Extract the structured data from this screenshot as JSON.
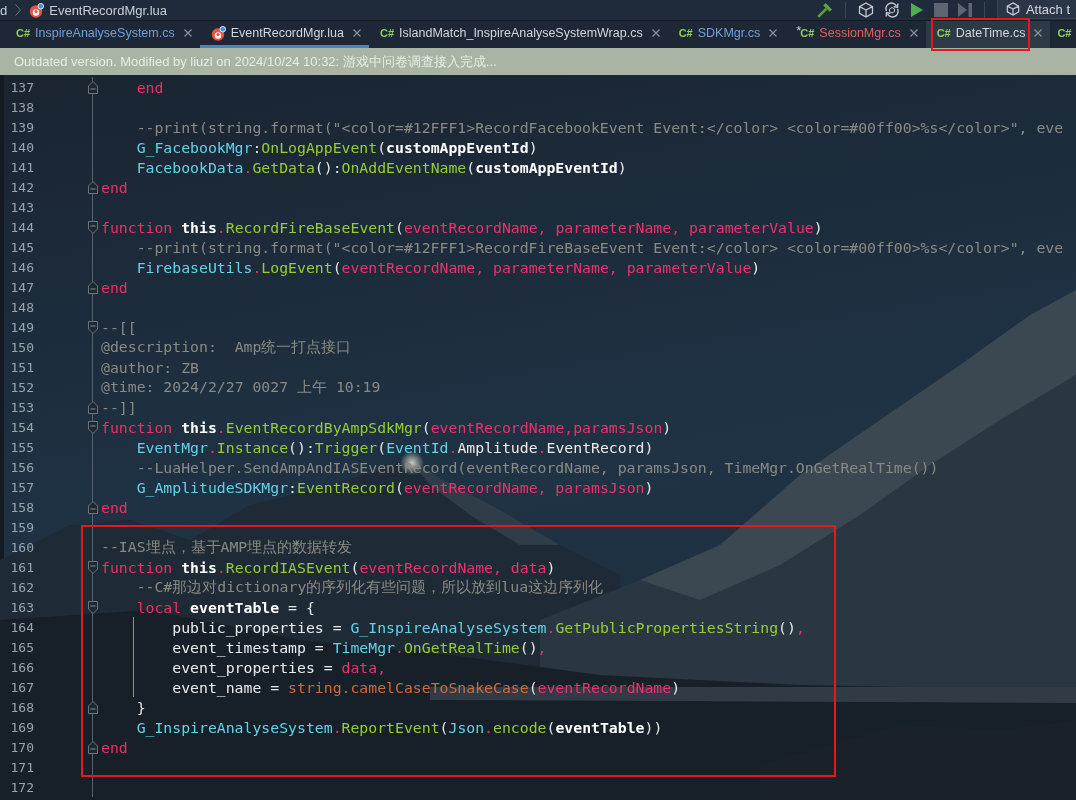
{
  "breadcrumb": [
    {
      "kind": "folder",
      "text": "d"
    },
    {
      "kind": "lua",
      "text": "EventRecordMgr.lua"
    }
  ],
  "toolbar": {
    "groups": [
      {
        "buttons": [
          {
            "kind": "build",
            "disabled": false
          }
        ]
      },
      {
        "buttons": [
          {
            "kind": "cube",
            "disabled": false
          },
          {
            "kind": "refresh",
            "disabled": false
          },
          {
            "kind": "run",
            "disabled": false
          },
          {
            "kind": "stop",
            "disabled": true
          },
          {
            "kind": "step",
            "disabled": true
          }
        ]
      }
    ],
    "attach_button": {
      "label": "Attach t"
    }
  },
  "tabs": [
    {
      "kind": "csharp",
      "badge": "C#",
      "label": "InspireAnalyseSystem.cs",
      "color": "#6fa0dc",
      "selected": false,
      "hovered": false,
      "annotated": false,
      "closable": true
    },
    {
      "kind": "lua",
      "label": "EventRecordMgr.lua",
      "color": "#d2d6dc",
      "selected": true,
      "hovered": false,
      "annotated": false,
      "closable": true
    },
    {
      "kind": "csharp",
      "badge": "C#",
      "label": "IslandMatch_InspireAnalyseSystemWrap.cs",
      "color": "#d2d6dc",
      "selected": false,
      "hovered": false,
      "annotated": false,
      "closable": true
    },
    {
      "kind": "csharp",
      "badge": "C#",
      "label": "SDKMgr.cs",
      "color": "#6fa0dc",
      "selected": false,
      "hovered": false,
      "annotated": false,
      "closable": true
    },
    {
      "kind": "csharp",
      "badge": "C#",
      "marker": "*",
      "label": "SessionMgr.cs",
      "color": "#e0625c",
      "selected": false,
      "hovered": false,
      "annotated": false,
      "closable": true
    },
    {
      "kind": "csharp",
      "badge": "C#",
      "label": "DateTime.cs",
      "color": "#d2d6dc",
      "selected": false,
      "hovered": true,
      "annotated": true,
      "closable": true
    },
    {
      "kind": "csharp",
      "badge": "C#",
      "selected": false,
      "hovered": false,
      "annotated": false
    }
  ],
  "banner": {
    "text": "Outdated version. Modified by liuzl on 2024/10/24 10:32: 游戏中问卷调查接入完成..."
  },
  "code_blocks": [
    {
      "boxed": false,
      "lines": [
        {
          "number": "137",
          "kind": "fold-end",
          "scope_guide": false,
          "tokens": [
            {
              "kind": "keyword",
              "text": "    end"
            }
          ]
        },
        {
          "number": "138",
          "kind": "plain",
          "scope_guide": false
        },
        {
          "number": "139",
          "kind": "plain",
          "scope_guide": false,
          "tokens": [
            {
              "kind": "comment",
              "text": "    --print(string.format(\"<color=#12FFF1>RecordFacebookEvent Event:</color> <color=#00ff00>%s</color>\", eve"
            }
          ]
        },
        {
          "number": "140",
          "kind": "plain",
          "scope_guide": false,
          "tokens": [
            {
              "kind": "global",
              "text": "    G_FacebookMgr"
            },
            {
              "kind": "punct",
              "text": ":"
            },
            {
              "kind": "method",
              "text": "OnLogAppEvent"
            },
            {
              "kind": "punct",
              "text": "("
            },
            {
              "kind": "local",
              "text": "customAppEventId"
            },
            {
              "kind": "punct",
              "text": ")"
            }
          ]
        },
        {
          "number": "141",
          "kind": "plain",
          "scope_guide": false,
          "tokens": [
            {
              "kind": "global",
              "text": "    FacebookData"
            },
            {
              "kind": "operator",
              "text": "."
            },
            {
              "kind": "method",
              "text": "GetData"
            },
            {
              "kind": "punct",
              "text": "():"
            },
            {
              "kind": "method",
              "text": "OnAddEventName"
            },
            {
              "kind": "punct",
              "text": "("
            },
            {
              "kind": "local",
              "text": "customAppEventId"
            },
            {
              "kind": "punct",
              "text": ")"
            }
          ]
        },
        {
          "number": "142",
          "kind": "fold-end",
          "scope_guide": false,
          "tokens": [
            {
              "kind": "keyword",
              "text": "end"
            }
          ]
        },
        {
          "number": "143",
          "kind": "plain",
          "scope_guide": false
        },
        {
          "number": "144",
          "kind": "fold-start",
          "scope_guide": false,
          "tokens": [
            {
              "kind": "keyword",
              "text": "function "
            },
            {
              "kind": "self",
              "text": "this"
            },
            {
              "kind": "operator",
              "text": "."
            },
            {
              "kind": "method",
              "text": "RecordFireBaseEvent"
            },
            {
              "kind": "punct",
              "text": "("
            },
            {
              "kind": "param",
              "text": "eventRecordName, parameterName, parameterValue"
            },
            {
              "kind": "punct",
              "text": ")"
            }
          ]
        },
        {
          "number": "145",
          "kind": "plain",
          "scope_guide": false,
          "tokens": [
            {
              "kind": "comment",
              "text": "    --print(string.format(\"<color=#12FFF1>RecordFireBaseEvent Event:</color> <color=#00ff00>%s</color>\", eve"
            }
          ]
        },
        {
          "number": "146",
          "kind": "plain",
          "scope_guide": false,
          "tokens": [
            {
              "kind": "global",
              "text": "    FirebaseUtils"
            },
            {
              "kind": "operator",
              "text": "."
            },
            {
              "kind": "method",
              "text": "LogEvent"
            },
            {
              "kind": "punct",
              "text": "("
            },
            {
              "kind": "param",
              "text": "eventRecordName, parameterName, parameterValue"
            },
            {
              "kind": "punct",
              "text": ")"
            }
          ]
        },
        {
          "number": "147",
          "kind": "fold-end",
          "scope_guide": false,
          "tokens": [
            {
              "kind": "keyword",
              "text": "end"
            }
          ]
        },
        {
          "number": "148",
          "kind": "plain",
          "scope_guide": false
        },
        {
          "number": "149",
          "kind": "fold-start",
          "scope_guide": false,
          "tokens": [
            {
              "kind": "comment",
              "text": "--[["
            }
          ]
        },
        {
          "number": "150",
          "kind": "plain",
          "scope_guide": false,
          "tokens": [
            {
              "kind": "comment",
              "text": "@description:  Amp统一打点接口"
            }
          ]
        },
        {
          "number": "151",
          "kind": "plain",
          "scope_guide": false,
          "tokens": [
            {
              "kind": "comment",
              "text": "@author: ZB"
            }
          ]
        },
        {
          "number": "152",
          "kind": "plain",
          "scope_guide": false,
          "tokens": [
            {
              "kind": "comment",
              "text": "@time: 2024/2/27 0027 上午 10:19"
            }
          ]
        },
        {
          "number": "153",
          "kind": "fold-end",
          "scope_guide": false,
          "tokens": [
            {
              "kind": "comment",
              "text": "--]]"
            }
          ]
        },
        {
          "number": "154",
          "kind": "fold-start",
          "scope_guide": false,
          "tokens": [
            {
              "kind": "keyword",
              "text": "function "
            },
            {
              "kind": "self",
              "text": "this"
            },
            {
              "kind": "operator",
              "text": "."
            },
            {
              "kind": "method",
              "text": "EventRecordByAmpSdkMgr"
            },
            {
              "kind": "punct",
              "text": "("
            },
            {
              "kind": "param",
              "text": "eventRecordName,paramsJson"
            },
            {
              "kind": "punct",
              "text": ")"
            }
          ]
        },
        {
          "number": "155",
          "kind": "plain",
          "scope_guide": false,
          "tokens": [
            {
              "kind": "global",
              "text": "    EventMgr"
            },
            {
              "kind": "operator",
              "text": "."
            },
            {
              "kind": "method",
              "text": "Instance"
            },
            {
              "kind": "punct",
              "text": "():"
            },
            {
              "kind": "method",
              "text": "Trigger"
            },
            {
              "kind": "punct",
              "text": "("
            },
            {
              "kind": "global",
              "text": "EventId"
            },
            {
              "kind": "operator",
              "text": "."
            },
            {
              "kind": "field",
              "text": "Amplitude"
            },
            {
              "kind": "operator",
              "text": "."
            },
            {
              "kind": "field",
              "text": "EventRecord"
            },
            {
              "kind": "punct",
              "text": ")"
            }
          ]
        },
        {
          "number": "156",
          "kind": "plain",
          "scope_guide": false,
          "tokens": [
            {
              "kind": "comment",
              "text": "    --LuaHelper.SendAmpAndIASEventRecord(eventRecordName, paramsJson, TimeMgr.OnGetRealTime())"
            }
          ]
        },
        {
          "number": "157",
          "kind": "plain",
          "scope_guide": false,
          "tokens": [
            {
              "kind": "global",
              "text": "    G_AmplitudeSDKMgr"
            },
            {
              "kind": "punct",
              "text": ":"
            },
            {
              "kind": "method",
              "text": "EventRecord"
            },
            {
              "kind": "punct",
              "text": "("
            },
            {
              "kind": "param",
              "text": "eventRecordName, paramsJson"
            },
            {
              "kind": "punct",
              "text": ")"
            }
          ]
        },
        {
          "number": "158",
          "kind": "fold-end",
          "scope_guide": false,
          "tokens": [
            {
              "kind": "keyword",
              "text": "end"
            }
          ]
        },
        {
          "number": "159",
          "kind": "plain",
          "scope_guide": false
        }
      ]
    },
    {
      "boxed": true,
      "lines": [
        {
          "number": "160",
          "kind": "plain",
          "scope_guide": false,
          "tokens": [
            {
              "kind": "comment",
              "text": "--IAS埋点，基于AMP埋点的数据转发"
            }
          ]
        },
        {
          "number": "161",
          "kind": "fold-start",
          "scope_guide": false,
          "tokens": [
            {
              "kind": "keyword",
              "text": "function "
            },
            {
              "kind": "self",
              "text": "this"
            },
            {
              "kind": "operator",
              "text": "."
            },
            {
              "kind": "method",
              "text": "RecordIASEvent"
            },
            {
              "kind": "punct",
              "text": "("
            },
            {
              "kind": "param",
              "text": "eventRecordName, data"
            },
            {
              "kind": "punct",
              "text": ")"
            }
          ]
        },
        {
          "number": "162",
          "kind": "plain",
          "scope_guide": false,
          "tokens": [
            {
              "kind": "comment",
              "text": "    --C#那边对dictionary的序列化有些问题，所以放到lua这边序列化"
            }
          ]
        },
        {
          "number": "163",
          "kind": "fold-start",
          "scope_guide": false,
          "tokens": [
            {
              "kind": "keyword",
              "text": "    local "
            },
            {
              "kind": "local",
              "text": "eventTable"
            },
            {
              "kind": "punct",
              "text": " = {"
            }
          ]
        },
        {
          "number": "164",
          "kind": "plain",
          "scope_guide": true,
          "tokens": [
            {
              "kind": "field",
              "text": "        public_properties"
            },
            {
              "kind": "punct",
              "text": " = "
            },
            {
              "kind": "global",
              "text": "G_InspireAnalyseSystem"
            },
            {
              "kind": "operator",
              "text": "."
            },
            {
              "kind": "method",
              "text": "GetPublicPropertiesString"
            },
            {
              "kind": "punct",
              "text": "()"
            },
            {
              "kind": "operator",
              "text": ","
            }
          ]
        },
        {
          "number": "165",
          "kind": "plain",
          "scope_guide": true,
          "tokens": [
            {
              "kind": "field",
              "text": "        event_timestamp"
            },
            {
              "kind": "punct",
              "text": " = "
            },
            {
              "kind": "global",
              "text": "TimeMgr"
            },
            {
              "kind": "operator",
              "text": "."
            },
            {
              "kind": "method",
              "text": "OnGetRealTime"
            },
            {
              "kind": "punct",
              "text": "()"
            },
            {
              "kind": "operator",
              "text": ","
            }
          ]
        },
        {
          "number": "166",
          "kind": "plain",
          "scope_guide": true,
          "tokens": [
            {
              "kind": "field",
              "text": "        event_properties"
            },
            {
              "kind": "punct",
              "text": " = "
            },
            {
              "kind": "param",
              "text": "data,"
            }
          ]
        },
        {
          "number": "167",
          "kind": "plain",
          "scope_guide": true,
          "tokens": [
            {
              "kind": "field",
              "text": "        event_name"
            },
            {
              "kind": "punct",
              "text": " = "
            },
            {
              "kind": "stringlib",
              "text": "string.camelCaseToSnakeCase"
            },
            {
              "kind": "punct",
              "text": "("
            },
            {
              "kind": "param",
              "text": "eventRecordName"
            },
            {
              "kind": "punct",
              "text": ")"
            }
          ]
        },
        {
          "number": "168",
          "kind": "fold-end",
          "scope_guide": false,
          "tokens": [
            {
              "kind": "punct",
              "text": "    }"
            }
          ]
        },
        {
          "number": "169",
          "kind": "plain",
          "scope_guide": false,
          "tokens": [
            {
              "kind": "global",
              "text": "    G_InspireAnalyseSystem"
            },
            {
              "kind": "operator",
              "text": "."
            },
            {
              "kind": "method",
              "text": "ReportEvent"
            },
            {
              "kind": "punct",
              "text": "("
            },
            {
              "kind": "global",
              "text": "Json"
            },
            {
              "kind": "operator",
              "text": "."
            },
            {
              "kind": "method",
              "text": "encode"
            },
            {
              "kind": "punct",
              "text": "("
            },
            {
              "kind": "local",
              "text": "eventTable"
            },
            {
              "kind": "punct",
              "text": "))"
            }
          ]
        },
        {
          "number": "170",
          "kind": "fold-end",
          "scope_guide": false,
          "tokens": [
            {
              "kind": "keyword",
              "text": "end"
            }
          ]
        },
        {
          "number": "171",
          "kind": "plain",
          "scope_guide": false
        }
      ]
    },
    {
      "boxed": false,
      "lines": [
        {
          "number": "172",
          "kind": "plain",
          "scope_guide": false
        }
      ]
    }
  ]
}
